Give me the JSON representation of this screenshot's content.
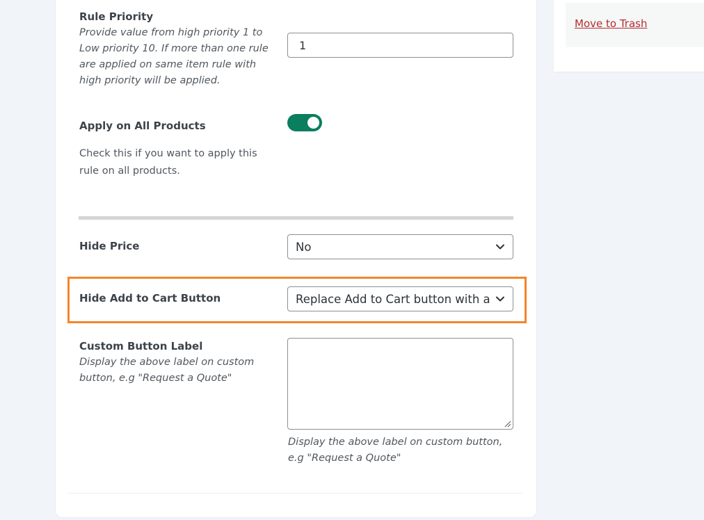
{
  "sidebar": {
    "trash_link": "Move to Trash"
  },
  "rule_priority": {
    "label": "Rule Priority",
    "description": "Provide value from high priority 1 to Low priority 10. If more than one rule are applied on same item rule with high priority will be applied.",
    "value": "1"
  },
  "apply_all": {
    "label": "Apply on All Products",
    "description": "Check this if you want to apply this rule on all products.",
    "enabled": true
  },
  "hide_price": {
    "label": "Hide Price",
    "selected": "No"
  },
  "hide_cart": {
    "label": "Hide Add to Cart Button",
    "selected": "Replace Add to Cart button with a Quote button"
  },
  "custom_label": {
    "label": "Custom Button Label",
    "description": "Display the above label on custom button, e.g \"Request a Quote\"",
    "value": "",
    "help": "Display the above label on custom button, e.g \"Request a Quote\""
  },
  "colors": {
    "toggle_on": "#0a7e5e",
    "highlight": "#f5852a",
    "trash_link": "#b32d2e"
  },
  "icons": {
    "select_arrow": "chevron-down-icon",
    "textarea_resize": "resize-grip-icon"
  }
}
